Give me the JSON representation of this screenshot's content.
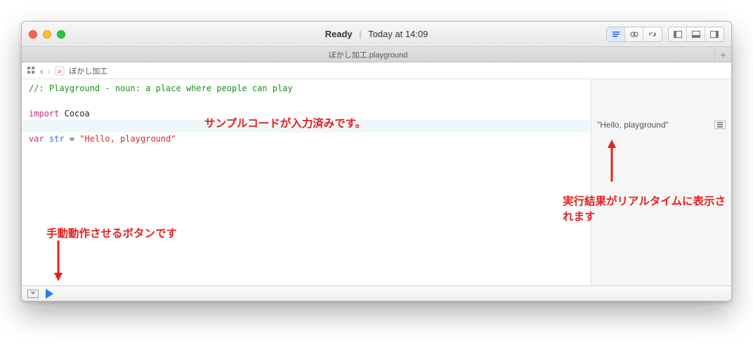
{
  "titlebar": {
    "status": "Ready",
    "time_label": "Today at 14:09"
  },
  "tab": {
    "filename": "ぼかし加工.playground"
  },
  "breadcrumb": {
    "file_label": "ぼかし加工"
  },
  "code": {
    "comment": "//: Playground - noun: a place where people can play",
    "import_kw": "import",
    "import_module": "Cocoa",
    "var_kw": "var",
    "var_name": "str",
    "eq": " = ",
    "string_literal": "\"Hello, playground\""
  },
  "results": {
    "value": "\"Hello, playground\""
  },
  "annotations": {
    "sample_code": "サンプルコードが入力済みです。",
    "run_button": "手動動作させるボタンです",
    "result_live": "実行結果がリアルタイムに表示されます"
  },
  "icons": {
    "close": "close-icon",
    "minimize": "minimize-icon",
    "zoom": "zoom-icon"
  }
}
